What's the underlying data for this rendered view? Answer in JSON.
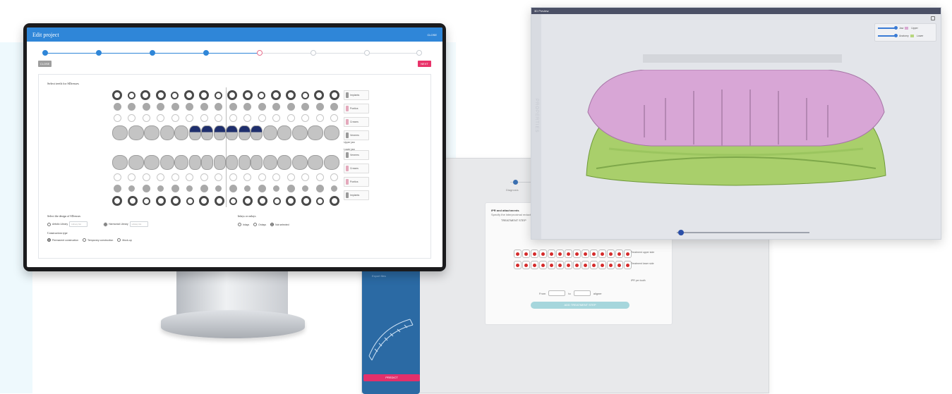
{
  "colors": {
    "primary": "#2f86d8",
    "accent": "#e8336a",
    "selected_tooth": "#1f2f6d",
    "model_upper": "#d8a6d6",
    "model_lower": "#a9cf6b"
  },
  "editor": {
    "title": "Edit project",
    "close_link": "CLOSE",
    "btn_close": "CLOSE",
    "btn_next": "NEXT",
    "select_heading": "Select teeth for SDresses",
    "upper_jaw": "Upper jaw",
    "lower_jaw": "Lower jaw",
    "side_items": [
      "Implants",
      "Pontics",
      "Crowns",
      "Veneers",
      "Veneers",
      "Crowns",
      "Pontics",
      "Implants"
    ],
    "design_title": "Select the design of SDresses",
    "design_opt1": "Artistic Library",
    "design_opt2": "Harmonial Library",
    "library_placeholder": "Library list",
    "inlays_title": "Inlays or onlays",
    "inlays_opt1": "Inlays",
    "inlays_opt2": "Onlays",
    "inlays_opt3": "Not selected",
    "construction_title": "Construction type",
    "construction_opt1": "Permanent construction",
    "construction_opt2": "Temporary construction",
    "construction_opt3": "Mock-up"
  },
  "preview": {
    "title": "3D Preview",
    "row1_label": "Jaw",
    "row1_value": "Upper",
    "row2_label": "Anatomy",
    "row2_value": "Lower",
    "side_text": "PROPERTIES"
  },
  "treatment": {
    "hint": "Select a diagnosis treatment plan below",
    "step_label": "Diagnosis",
    "card_title": "IPR and attachments",
    "card_sub": "Specify the interproximal reductions and attachments",
    "card_step": "TREATMENT STEP",
    "note_upper": "Treatment upper side",
    "note_lower": "Treatment lower side",
    "note_ipr": "IPR per tooth",
    "from_label": "From",
    "to_label": "to",
    "aligner_label": "aligner",
    "add_button": "ADD TREATMENT STEP",
    "panel_label": "Export files",
    "predict_button": "PREDICT"
  }
}
